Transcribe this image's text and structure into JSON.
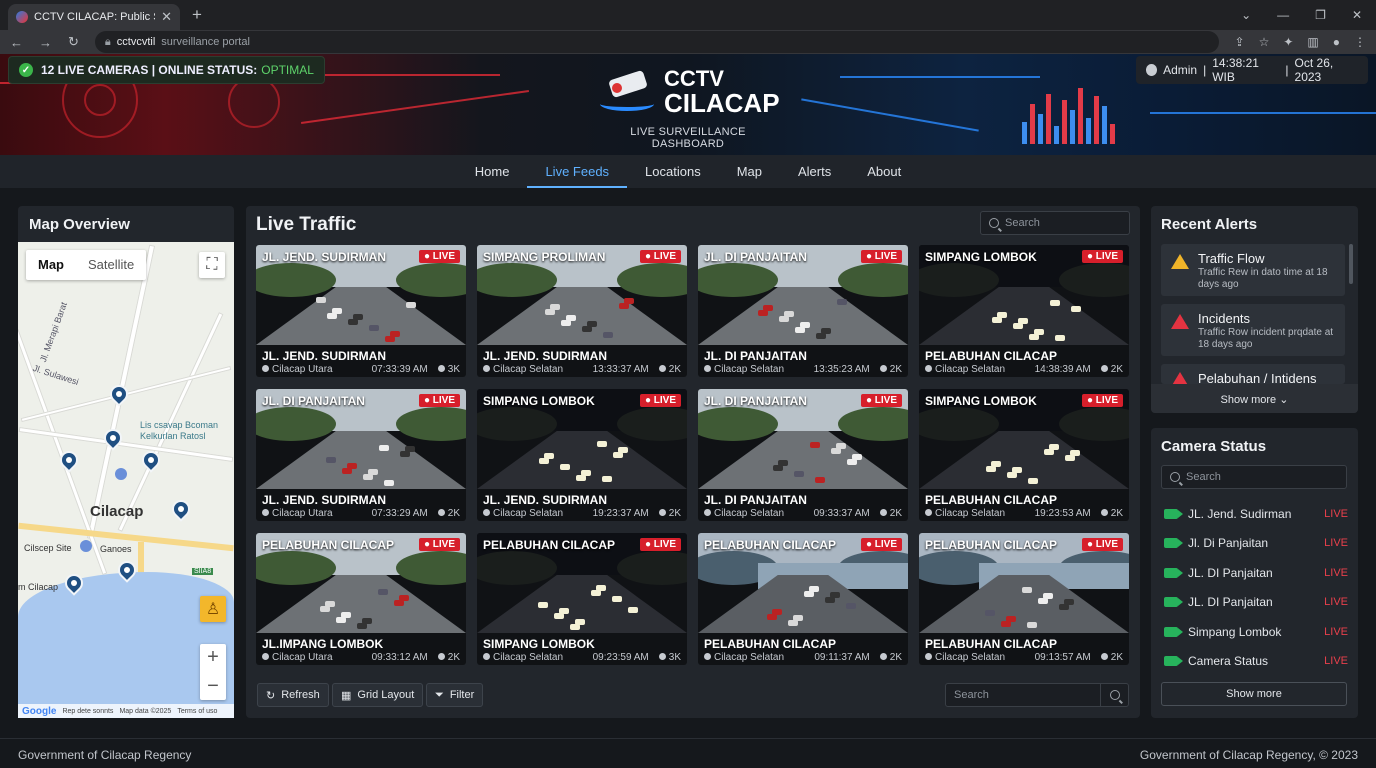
{
  "browser": {
    "tab_title": "CCTV CILACAP: Public Surveilla",
    "address_host": "cctvcvtil",
    "address_path": "surveillance portal"
  },
  "header": {
    "status_text": "12 LIVE CAMERAS | ONLINE STATUS:",
    "status_value": "OPTIMAL",
    "brand_line1": "CCTV",
    "brand_line2": "CILACAP",
    "tagline": "LIVE SURVEILLANCE DASHBOARD",
    "user": "Admin",
    "time": "14:38:21 WIB",
    "date": "Oct 26, 2023"
  },
  "nav": {
    "items": [
      "Home",
      "Live Feeds",
      "Locations",
      "Map",
      "Alerts",
      "About"
    ],
    "active": "Live Feeds"
  },
  "map": {
    "title": "Map Overview",
    "tab_map": "Map",
    "tab_satellite": "Satellite",
    "city": "Cilacap",
    "label_1": "Lis csavap Bcoman",
    "label_2": "Kelkurlan Ratosl",
    "label_3": "Cilscep Site",
    "label_4": "Ganoes",
    "label_5": "m Cilacap",
    "label_6": "Jl. Sulawesi",
    "label_7": "Jl. Merapi Barat",
    "road_badge": "SIIA8",
    "zoom_in": "+",
    "zoom_out": "−",
    "footer_brand": "Google",
    "footer_1": "Rep dete sonnts",
    "footer_2": "Map data ©2025",
    "footer_3": "Terms of uso"
  },
  "feeds": {
    "title": "Live Traffic",
    "search_placeholder": "Search",
    "live_badge": "LIVE",
    "cameras": [
      {
        "title": "JL. JEND. SUDIRMAN",
        "name": "JL. JEND. SUDIRMAN",
        "location": "Cilacap Utara",
        "time": "07:33:39 AM",
        "viewers": "3K"
      },
      {
        "title": "SIMPANG PROLIMAN",
        "name": "JL. JEND. SUDIRMAN",
        "location": "Cilacap Selatan",
        "time": "13:33:37 AM",
        "viewers": "2K"
      },
      {
        "title": "JL. DI PANJAITAN",
        "name": "JL. DI PANJAITAN",
        "location": "Cilacap Selatan",
        "time": "13:35:23 AM",
        "viewers": "2K"
      },
      {
        "title": "SIMPANG LOMBOK",
        "name": "PELABUHAN CILACAP",
        "location": "Cilacap Selatan",
        "time": "14:38:39 AM",
        "viewers": "2K"
      },
      {
        "title": "JL. DI PANJAITAN",
        "name": "JL. JEND. SUDIRMAN",
        "location": "Cilacap Utara",
        "time": "07:33:29 AM",
        "viewers": "2K"
      },
      {
        "title": "SIMPANG LOMBOK",
        "name": "JL. JEND. SUDIRMAN",
        "location": "Cilacap Selatan",
        "time": "19:23:37 AM",
        "viewers": "2K"
      },
      {
        "title": "JL. DI PANJAITAN",
        "name": "JL. DI PANJAITAN",
        "location": "Cilacap Selatan",
        "time": "09:33:37 AM",
        "viewers": "2K"
      },
      {
        "title": "SIMPANG LOMBOK",
        "name": "PELABUHAN CILACAP",
        "location": "Cilacap Selatan",
        "time": "19:23:53 AM",
        "viewers": "2K"
      },
      {
        "title": "PELABUHAN CILACAP",
        "name": "JL.IMPANG LOMBOK",
        "location": "Cilacap Utara",
        "time": "09:33:12 AM",
        "viewers": "2K"
      },
      {
        "title": "PELABUHAN CILACAP",
        "name": "SIMPANG LOMBOK",
        "location": "Cilacap Selatan",
        "time": "09:23:59 AM",
        "viewers": "3K"
      },
      {
        "title": "PELABUHAN CILACAP",
        "name": "PELABUHAN CILACAP",
        "location": "Cilacap Selatan",
        "time": "09:11:37 AM",
        "viewers": "2K"
      },
      {
        "title": "PELABUHAN CILACAP",
        "name": "PELABUHAN CILACAP",
        "location": "Cilacap Selatan",
        "time": "09:13:57 AM",
        "viewers": "2K"
      }
    ],
    "btn_refresh": "Refresh",
    "btn_grid": "Grid Layout",
    "btn_filter": "Filter",
    "bottom_search_placeholder": "Search"
  },
  "alerts": {
    "title": "Recent Alerts",
    "items": [
      {
        "title": "Traffic Flow",
        "desc": "Traffic Rew in dato time at 18 days ago"
      },
      {
        "title": "Incidents",
        "desc": "Traffic Row incident prqdate at 18 days ago"
      },
      {
        "title": "Pelabuhan / Intidens",
        "desc": ""
      }
    ],
    "show_more": "Show more"
  },
  "camera_status": {
    "title": "Camera Status",
    "search_placeholder": "Search",
    "items": [
      {
        "name": "JL. Jend. Sudirman",
        "status": "LIVE"
      },
      {
        "name": "Jl. Di Panjaitan",
        "status": "LIVE"
      },
      {
        "name": "JL. DI Panjaitan",
        "status": "LIVE"
      },
      {
        "name": "JL. DI Panjaitan",
        "status": "LIVE"
      },
      {
        "name": "Simpang Lombok",
        "status": "LIVE"
      },
      {
        "name": "Camera Status",
        "status": "LIVE"
      }
    ],
    "show_more": "Show more"
  },
  "footer": {
    "left": "Government of Cilacap Regency",
    "right": "Government of Cilacap Regency, © 2023"
  },
  "colors": {
    "accent": "#5fb1ff",
    "live_red": "#d71f2b",
    "ok_green": "#3bb54a"
  }
}
